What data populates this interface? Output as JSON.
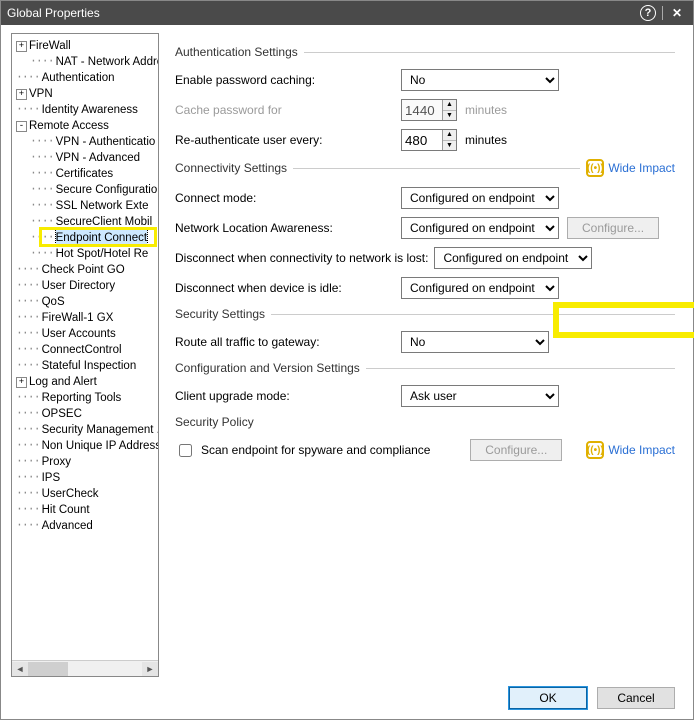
{
  "window": {
    "title": "Global Properties"
  },
  "tree": {
    "items": [
      {
        "expand": "+",
        "indent": 0,
        "label": "FireWall"
      },
      {
        "expand": "",
        "indent": 1,
        "label": "NAT - Network Addres"
      },
      {
        "expand": "",
        "indent": 0,
        "label": "Authentication"
      },
      {
        "expand": "+",
        "indent": 0,
        "label": "VPN"
      },
      {
        "expand": "",
        "indent": 0,
        "label": "Identity Awareness"
      },
      {
        "expand": "-",
        "indent": 0,
        "label": "Remote Access"
      },
      {
        "expand": "",
        "indent": 1,
        "label": "VPN - Authenticatio"
      },
      {
        "expand": "",
        "indent": 1,
        "label": "VPN - Advanced"
      },
      {
        "expand": "",
        "indent": 1,
        "label": "Certificates"
      },
      {
        "expand": "",
        "indent": 1,
        "label": "Secure Configuratio"
      },
      {
        "expand": "",
        "indent": 1,
        "label": "SSL Network Exte"
      },
      {
        "expand": "",
        "indent": 1,
        "label": "SecureClient Mobil"
      },
      {
        "expand": "",
        "indent": 1,
        "label": "Endpoint Connect",
        "selected": true
      },
      {
        "expand": "",
        "indent": 1,
        "label": "Hot Spot/Hotel Re"
      },
      {
        "expand": "",
        "indent": 0,
        "label": "Check Point GO"
      },
      {
        "expand": "",
        "indent": 0,
        "label": "User Directory"
      },
      {
        "expand": "",
        "indent": 0,
        "label": "QoS"
      },
      {
        "expand": "",
        "indent": 0,
        "label": "FireWall-1 GX"
      },
      {
        "expand": "",
        "indent": 0,
        "label": "User Accounts"
      },
      {
        "expand": "",
        "indent": 0,
        "label": "ConnectControl"
      },
      {
        "expand": "",
        "indent": 0,
        "label": "Stateful Inspection"
      },
      {
        "expand": "+",
        "indent": 0,
        "label": "Log and Alert"
      },
      {
        "expand": "",
        "indent": 0,
        "label": "Reporting Tools"
      },
      {
        "expand": "",
        "indent": 0,
        "label": "OPSEC"
      },
      {
        "expand": "",
        "indent": 0,
        "label": "Security Management ."
      },
      {
        "expand": "",
        "indent": 0,
        "label": "Non Unique IP Address"
      },
      {
        "expand": "",
        "indent": 0,
        "label": "Proxy"
      },
      {
        "expand": "",
        "indent": 0,
        "label": "IPS"
      },
      {
        "expand": "",
        "indent": 0,
        "label": "UserCheck"
      },
      {
        "expand": "",
        "indent": 0,
        "label": "Hit Count"
      },
      {
        "expand": "",
        "indent": 0,
        "label": "Advanced"
      }
    ]
  },
  "sections": {
    "auth": {
      "title": "Authentication Settings",
      "enable_caching_label": "Enable password caching:",
      "enable_caching_value": "No",
      "cache_for_label": "Cache password for",
      "cache_for_value": "1440",
      "cache_for_unit": "minutes",
      "reauth_label": "Re-authenticate user every:",
      "reauth_value": "480",
      "reauth_unit": "minutes"
    },
    "conn": {
      "title": "Connectivity Settings",
      "wide_impact": "Wide Impact",
      "connect_mode_label": "Connect mode:",
      "connect_mode_value": "Configured on endpoint client",
      "nla_label": "Network Location Awareness:",
      "nla_value": "Configured on endpoint client",
      "nla_configure": "Configure...",
      "disc_net_label": "Disconnect when connectivity to network is lost:",
      "disc_net_value": "Configured on endpoint client",
      "disc_idle_label": "Disconnect when device is idle:",
      "disc_idle_value": "Configured on endpoint client"
    },
    "sec": {
      "title": "Security Settings",
      "route_label": "Route all traffic to gateway:",
      "route_value": "No"
    },
    "cfg": {
      "title": "Configuration and Version Settings",
      "upgrade_label": "Client upgrade mode:",
      "upgrade_value": "Ask user",
      "policy_label": "Security Policy",
      "scan_label": "Scan endpoint for spyware and compliance",
      "configure": "Configure...",
      "wide_impact": "Wide Impact"
    }
  },
  "footer": {
    "ok": "OK",
    "cancel": "Cancel"
  }
}
